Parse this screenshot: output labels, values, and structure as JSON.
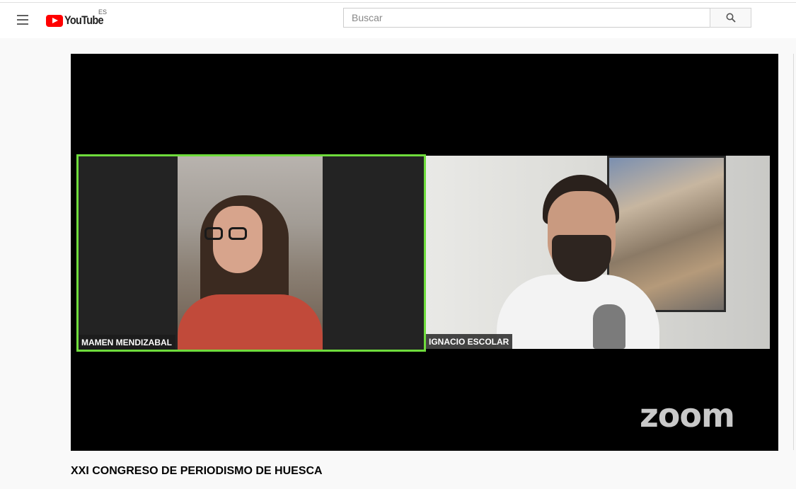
{
  "masthead": {
    "logo_text": "YouTube",
    "country_code": "ES",
    "search_placeholder": "Buscar",
    "colors": {
      "logo_red": "#ff0000",
      "background": "#ffffff"
    }
  },
  "player": {
    "participants": [
      {
        "name": "MAMEN MENDIZABAL",
        "active_speaker": true,
        "highlight_color": "#6fdc3c"
      },
      {
        "name": "IGNACIO ESCOLAR",
        "active_speaker": false
      }
    ],
    "watermark": "zoom"
  },
  "video": {
    "title": "XXI CONGRESO DE PERIODISMO DE HUESCA"
  },
  "icons": {
    "menu": "hamburger-menu-icon",
    "search": "search-icon",
    "logo": "youtube-play-icon"
  }
}
